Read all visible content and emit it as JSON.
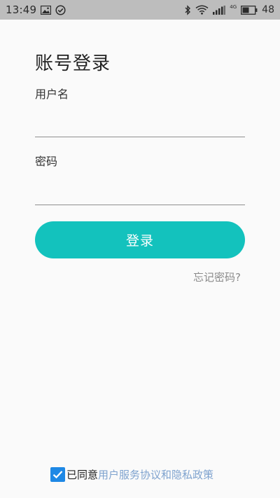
{
  "status_bar": {
    "time": "13:49",
    "network_label": "4G",
    "battery_level": "48"
  },
  "login": {
    "title": "账号登录",
    "username_label": "用户名",
    "username_value": "",
    "password_label": "密码",
    "password_value": "",
    "submit_label": "登录",
    "forgot_label": "忘记密码?"
  },
  "agreement": {
    "checked": true,
    "prefix": "已同意",
    "link_text": "用户服务协议和隐私政策"
  },
  "colors": {
    "accent": "#13c2bd",
    "checkbox": "#1e88e5",
    "link": "#7fa3cf",
    "status_bar_bg": "#bdbdbd"
  }
}
